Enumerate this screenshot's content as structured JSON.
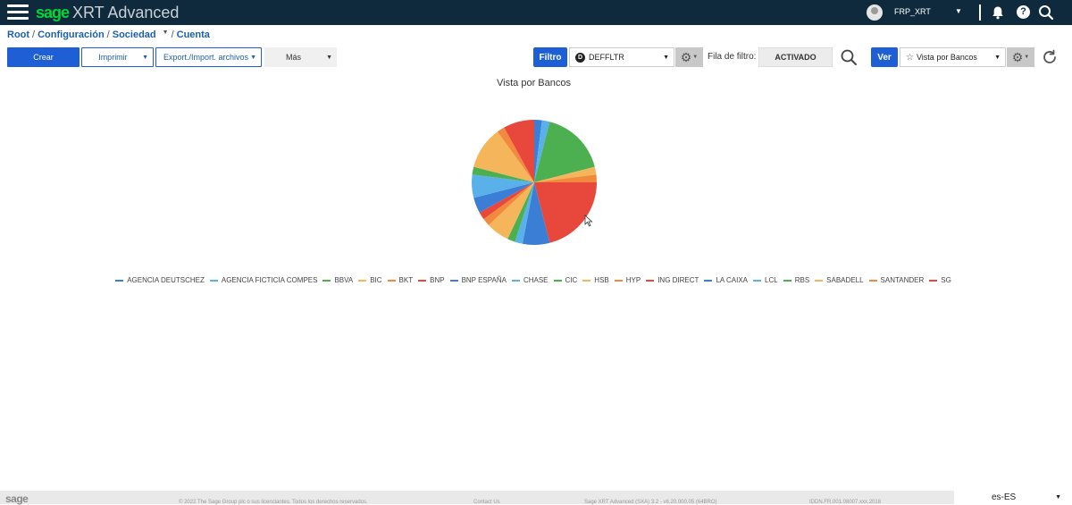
{
  "app": {
    "brand": "sage",
    "title": "XRT Advanced",
    "username": "FRP_XRT"
  },
  "breadcrumb": [
    "Root",
    "Configuración",
    "Sociedad",
    "Cuenta"
  ],
  "toolbar": {
    "crear": "Crear",
    "imprimir": "Imprimir",
    "export": "Export./Import. archivos",
    "mas": "Más",
    "filtro": "Filtro",
    "filter_value": "DEFFLTR",
    "filter_badge": "D",
    "fila_label": "Fila de filtro:",
    "fila_value": "ACTIVADO",
    "ver": "Ver",
    "vista_value": "Vista por Bancos"
  },
  "chart_data": {
    "type": "pie",
    "title": "Vista por Bancos",
    "legend_position": "bottom",
    "slices": [
      {
        "name": "AGENCIA DEUTSCHEZ",
        "value": 2.0,
        "color": "#3a7fd5"
      },
      {
        "name": "AGENCIA FICTICIA COMPES",
        "value": 2.0,
        "color": "#5ab1ea"
      },
      {
        "name": "BBVA",
        "value": 17.0,
        "color": "#4caf50"
      },
      {
        "name": "BIC",
        "value": 2.0,
        "color": "#f4b55b"
      },
      {
        "name": "BKT",
        "value": 2.0,
        "color": "#f28a3d"
      },
      {
        "name": "BNP",
        "value": 21.0,
        "color": "#e8473b"
      },
      {
        "name": "BNP ESPAÑA",
        "value": 7.0,
        "color": "#3a7fd5"
      },
      {
        "name": "CHASE",
        "value": 2.0,
        "color": "#5ab1ea"
      },
      {
        "name": "CIC",
        "value": 2.0,
        "color": "#4caf50"
      },
      {
        "name": "HSB",
        "value": 6.0,
        "color": "#f4b55b"
      },
      {
        "name": "HYP",
        "value": 2.0,
        "color": "#f28a3d"
      },
      {
        "name": "ING DIRECT",
        "value": 2.0,
        "color": "#e8473b"
      },
      {
        "name": "LA CAIXA",
        "value": 4.0,
        "color": "#3a7fd5"
      },
      {
        "name": "LCL",
        "value": 6.0,
        "color": "#5ab1ea"
      },
      {
        "name": "RBS",
        "value": 2.0,
        "color": "#4caf50"
      },
      {
        "name": "SABADELL",
        "value": 11.0,
        "color": "#f4b55b"
      },
      {
        "name": "SANTANDER",
        "value": 2.0,
        "color": "#f28a3d"
      },
      {
        "name": "SG",
        "value": 8.0,
        "color": "#e8473b"
      }
    ]
  },
  "footer": {
    "brand": "sage",
    "copyright": "© 2022 The Sage Group plc o sus licenciantes. Todos los derechos reservados.",
    "contact": "Contact Us",
    "version": "Sage XRT Advanced (SXA) 3.2 - v6.20.000.05 (64BRO)",
    "id": "IDDN.FR.001.08007.xxx.2018",
    "lang": "es-ES"
  },
  "icons": [
    "menu-icon",
    "bell-icon",
    "help-icon",
    "search-icon",
    "gear-icon",
    "star-icon",
    "refresh-icon",
    "chevron-down-icon"
  ]
}
